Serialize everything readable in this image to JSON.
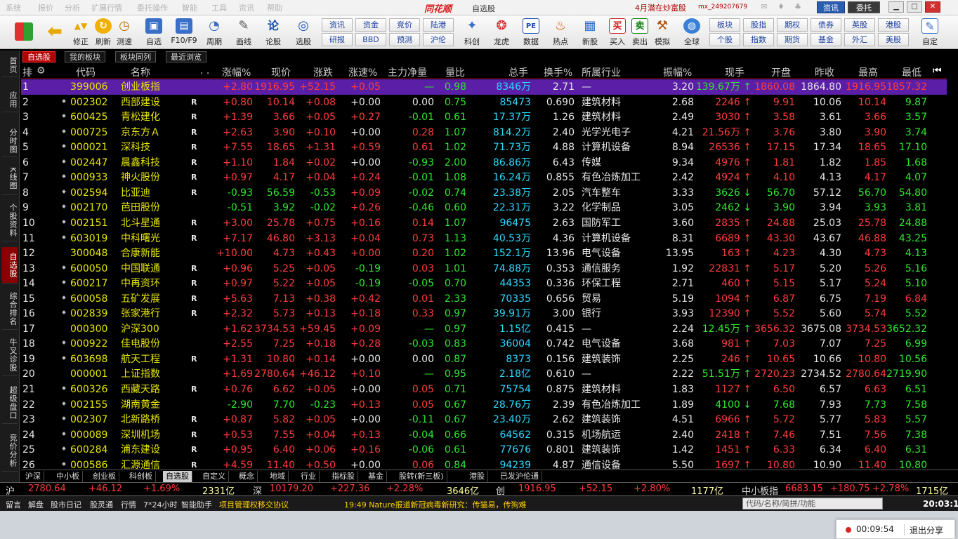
{
  "menu": {
    "items": [
      "系统",
      "报价",
      "分析",
      "扩展行情",
      "委托操作",
      "智能",
      "工具",
      "资讯",
      "帮助"
    ],
    "logo": "同花顺",
    "window_title": "自选股",
    "promo": "4月潜在炒富股",
    "account": "mx_249207679",
    "btn_zixun": "资讯",
    "btn_weituo": "委托"
  },
  "toolbar": {
    "big": [
      {
        "label": "",
        "icon": "colorful-grid-icon"
      },
      {
        "label": "",
        "icon": "back-arrow-icon"
      },
      {
        "label": "修正",
        "icon": "arrow-updown-icon"
      },
      {
        "label": "刷新",
        "icon": "refresh-icon"
      },
      {
        "label": "测速",
        "icon": "clock-icon"
      },
      {
        "label": "自选",
        "icon": "bookmark-icon"
      },
      {
        "label": "F10/F9",
        "icon": "f10-icon"
      },
      {
        "label": "周期",
        "icon": "cycle-icon"
      },
      {
        "label": "画线",
        "icon": "pencil-icon"
      },
      {
        "label": "论股",
        "icon": "discuss-icon"
      },
      {
        "label": "选股",
        "icon": "stock-pick-icon"
      }
    ],
    "small": [
      "资讯",
      "资金",
      "竞价",
      "陆港",
      "研报",
      "BBD",
      "预测",
      "沪伦"
    ],
    "big2": [
      {
        "label": "科创",
        "icon": "star-icon"
      },
      {
        "label": "龙虎",
        "icon": "dragon-icon"
      },
      {
        "label": "数据",
        "icon": "pe-icon"
      },
      {
        "label": "热点",
        "icon": "fire-icon"
      },
      {
        "label": "新股",
        "icon": "new-stock-icon"
      },
      {
        "label": "买入",
        "icon": "buy-icon",
        "glyph": "买"
      },
      {
        "label": "卖出",
        "icon": "sell-icon",
        "glyph": "卖"
      },
      {
        "label": "模拟",
        "icon": "hammer-icon"
      },
      {
        "label": "全球",
        "icon": "globe-icon"
      }
    ],
    "small2": [
      "板块",
      "股指",
      "期权",
      "债券",
      "英股",
      "港股",
      "个股",
      "指数",
      "期货",
      "基金",
      "外汇",
      "美股"
    ],
    "custom": "自定"
  },
  "sidebar": [
    "首页",
    "应用",
    "分时图",
    "K线图",
    "个股资料",
    "自选股",
    "综合排名",
    "牛叉诊股",
    "超级盘口",
    "竞价分析"
  ],
  "subtabs": [
    "自选股",
    "我的板块",
    "板块同列",
    "最近浏览"
  ],
  "headers": {
    "idx": "排",
    "code": "代码",
    "name": "名称",
    "dots": ". .",
    "chg_pct": "涨幅%",
    "price": "现价",
    "chg": "涨跌",
    "speed": "涨速%",
    "mainflow": "主力净量",
    "volratio": "量比",
    "vol": "总手",
    "turnover": "换手%",
    "industry": "所属行业",
    "amplitude": "振幅%",
    "lastvol": "现手",
    "open": "开盘",
    "preclose": "昨收",
    "high": "最高",
    "low": "最低"
  },
  "rows": [
    [
      "1",
      "399006",
      "创业板指",
      "",
      "+2.80",
      "1916.95",
      "+52.15",
      "+0.05",
      "—",
      "0.98",
      "8346万",
      "2.71",
      "—",
      "3.20",
      "139.67万 ↑",
      "1860.08",
      "1864.80",
      "1916.95",
      "1857.32",
      "r",
      "r",
      "r",
      "r",
      "g",
      "g",
      "g",
      "g",
      "r",
      "r"
    ],
    [
      "2",
      "002302",
      "西部建设",
      "R",
      "+0.80",
      "10.14",
      "+0.08",
      "+0.00",
      "0.00",
      "0.75",
      "85473",
      "0.690",
      "建筑材料",
      "2.68",
      "2246 ↑",
      "9.91",
      "10.06",
      "10.14",
      "9.87",
      "r",
      "r",
      "r",
      "w",
      "w",
      "g",
      "g",
      "r",
      "r",
      "g"
    ],
    [
      "3",
      "600425",
      "青松建化",
      "R",
      "+1.39",
      "3.66",
      "+0.05",
      "+0.27",
      "-0.01",
      "0.61",
      "17.37万",
      "1.26",
      "建筑材料",
      "2.49",
      "3030 ↑",
      "3.58",
      "3.61",
      "3.66",
      "3.57",
      "r",
      "r",
      "r",
      "r",
      "g",
      "g",
      "g",
      "r",
      "r",
      "g"
    ],
    [
      "4",
      "000725",
      "京东方Ａ",
      "R",
      "+2.63",
      "3.90",
      "+0.10",
      "+0.00",
      "0.28",
      "1.07",
      "814.2万",
      "2.40",
      "光学光电子",
      "4.21",
      "21.56万 ↑",
      "3.76",
      "3.80",
      "3.90",
      "3.74",
      "r",
      "r",
      "r",
      "w",
      "r",
      "g",
      "g",
      "r",
      "r",
      "g"
    ],
    [
      "5",
      "000021",
      "深科技",
      "R",
      "+7.55",
      "18.65",
      "+1.31",
      "+0.59",
      "0.61",
      "1.02",
      "71.73万",
      "4.88",
      "计算机设备",
      "8.94",
      "26536 ↑",
      "17.15",
      "17.34",
      "18.65",
      "17.10",
      "r",
      "r",
      "r",
      "r",
      "r",
      "g",
      "g",
      "r",
      "r",
      "g"
    ],
    [
      "6",
      "002447",
      "晨鑫科技",
      "R",
      "+1.10",
      "1.84",
      "+0.02",
      "+0.00",
      "-0.93",
      "2.00",
      "86.86万",
      "6.43",
      "传媒",
      "9.34",
      "4976 ↑",
      "1.81",
      "1.82",
      "1.85",
      "1.68",
      "r",
      "r",
      "r",
      "w",
      "g",
      "g",
      "g",
      "r",
      "r",
      "g"
    ],
    [
      "7",
      "000933",
      "神火股份",
      "R",
      "+0.97",
      "4.17",
      "+0.04",
      "+0.24",
      "-0.01",
      "1.08",
      "16.24万",
      "0.855",
      "有色冶炼加工",
      "2.42",
      "4924 ↑",
      "4.10",
      "4.13",
      "4.17",
      "4.07",
      "r",
      "r",
      "r",
      "r",
      "g",
      "g",
      "g",
      "r",
      "r",
      "g"
    ],
    [
      "8",
      "002594",
      "比亚迪",
      "R",
      "-0.93",
      "56.59",
      "-0.53",
      "+0.09",
      "-0.02",
      "0.74",
      "23.38万",
      "2.05",
      "汽车整车",
      "3.33",
      "3626 ↓",
      "56.70",
      "57.12",
      "56.70",
      "54.80",
      "g",
      "g",
      "g",
      "r",
      "g",
      "g",
      "g",
      "g",
      "g",
      "g"
    ],
    [
      "9",
      "002170",
      "芭田股份",
      "",
      "-0.51",
      "3.92",
      "-0.02",
      "+0.26",
      "-0.46",
      "0.60",
      "22.31万",
      "3.22",
      "化学制品",
      "3.05",
      "2462 ↓",
      "3.90",
      "3.94",
      "3.93",
      "3.81",
      "g",
      "g",
      "g",
      "r",
      "g",
      "g",
      "g",
      "g",
      "g",
      "g"
    ],
    [
      "10",
      "002151",
      "北斗星通",
      "R",
      "+3.00",
      "25.78",
      "+0.75",
      "+0.16",
      "0.14",
      "1.07",
      "96475",
      "2.63",
      "国防军工",
      "3.60",
      "2835 ↑",
      "24.88",
      "25.03",
      "25.78",
      "24.88",
      "r",
      "r",
      "r",
      "r",
      "r",
      "g",
      "g",
      "r",
      "r",
      "g"
    ],
    [
      "11",
      "603019",
      "中科曙光",
      "R",
      "+7.17",
      "46.80",
      "+3.13",
      "+0.04",
      "0.73",
      "1.13",
      "40.53万",
      "4.36",
      "计算机设备",
      "8.31",
      "6689 ↑",
      "43.30",
      "43.67",
      "46.88",
      "43.25",
      "r",
      "r",
      "r",
      "r",
      "r",
      "g",
      "g",
      "r",
      "r",
      "g"
    ],
    [
      "12",
      "300048",
      "合康新能",
      "",
      "+10.00",
      "4.73",
      "+0.43",
      "+0.00",
      "0.20",
      "1.02",
      "152.1万",
      "13.96",
      "电气设备",
      "13.95",
      "163 ↑",
      "4.23",
      "4.30",
      "4.73",
      "4.13",
      "r",
      "r",
      "r",
      "r",
      "r",
      "g",
      "g",
      "r",
      "r",
      "g"
    ],
    [
      "13",
      "600050",
      "中国联通",
      "R",
      "+0.96",
      "5.25",
      "+0.05",
      "-0.19",
      "0.03",
      "1.01",
      "74.88万",
      "0.353",
      "通信服务",
      "1.92",
      "22831 ↑",
      "5.17",
      "5.20",
      "5.26",
      "5.16",
      "r",
      "r",
      "r",
      "g",
      "r",
      "g",
      "g",
      "r",
      "r",
      "g"
    ],
    [
      "14",
      "600217",
      "中再资环",
      "R",
      "+0.97",
      "5.22",
      "+0.05",
      "-0.19",
      "-0.05",
      "0.70",
      "44353",
      "0.336",
      "环保工程",
      "2.71",
      "460 ↑",
      "5.15",
      "5.17",
      "5.24",
      "5.10",
      "r",
      "r",
      "r",
      "g",
      "g",
      "g",
      "g",
      "r",
      "r",
      "g"
    ],
    [
      "15",
      "600058",
      "五矿发展",
      "R",
      "+5.63",
      "7.13",
      "+0.38",
      "+0.42",
      "0.01",
      "2.33",
      "70335",
      "0.656",
      "贸易",
      "5.19",
      "1094 ↑",
      "6.87",
      "6.75",
      "7.19",
      "6.84",
      "r",
      "r",
      "r",
      "r",
      "r",
      "g",
      "g",
      "r",
      "r",
      "r"
    ],
    [
      "16",
      "002839",
      "张家港行",
      "R",
      "+2.32",
      "5.73",
      "+0.13",
      "+0.18",
      "0.33",
      "0.97",
      "39.91万",
      "3.00",
      "银行",
      "3.93",
      "12390 ↑",
      "5.52",
      "5.60",
      "5.74",
      "5.52",
      "r",
      "r",
      "r",
      "r",
      "r",
      "g",
      "g",
      "r",
      "r",
      "g"
    ],
    [
      "17",
      "000300",
      "沪深300",
      "",
      "+1.62",
      "3734.53",
      "+59.45",
      "+0.09",
      "—",
      "0.97",
      "1.15亿",
      "0.415",
      "—",
      "2.24",
      "12.45万 ↑",
      "3656.32",
      "3675.08",
      "3734.53",
      "3652.32",
      "r",
      "r",
      "r",
      "r",
      "g",
      "g",
      "g",
      "g",
      "r",
      "g"
    ],
    [
      "18",
      "000922",
      "佳电股份",
      "",
      "+2.55",
      "7.25",
      "+0.18",
      "+0.28",
      "-0.03",
      "0.83",
      "36004",
      "0.742",
      "电气设备",
      "3.68",
      "981 ↑",
      "7.03",
      "7.07",
      "7.25",
      "6.99",
      "r",
      "r",
      "r",
      "r",
      "g",
      "g",
      "g",
      "r",
      "r",
      "g"
    ],
    [
      "19",
      "603698",
      "航天工程",
      "R",
      "+1.31",
      "10.80",
      "+0.14",
      "+0.00",
      "0.00",
      "0.87",
      "8373",
      "0.156",
      "建筑装饰",
      "2.25",
      "246 ↑",
      "10.65",
      "10.66",
      "10.80",
      "10.56",
      "r",
      "r",
      "r",
      "w",
      "w",
      "g",
      "g",
      "r",
      "r",
      "g"
    ],
    [
      "20",
      "000001",
      "上证指数",
      "",
      "+1.69",
      "2780.64",
      "+46.12",
      "+0.10",
      "—",
      "0.95",
      "2.18亿",
      "0.610",
      "—",
      "2.22",
      "51.51万 ↑",
      "2720.23",
      "2734.52",
      "2780.64",
      "2719.90",
      "r",
      "r",
      "r",
      "r",
      "g",
      "g",
      "g",
      "g",
      "r",
      "g"
    ],
    [
      "21",
      "600326",
      "西藏天路",
      "R",
      "+0.76",
      "6.62",
      "+0.05",
      "+0.00",
      "0.05",
      "0.71",
      "75754",
      "0.875",
      "建筑材料",
      "1.83",
      "1127 ↑",
      "6.50",
      "6.57",
      "6.63",
      "6.51",
      "r",
      "r",
      "r",
      "w",
      "r",
      "g",
      "g",
      "r",
      "r",
      "g"
    ],
    [
      "22",
      "002155",
      "湖南黄金",
      "",
      "-2.90",
      "7.70",
      "-0.23",
      "+0.13",
      "0.05",
      "0.67",
      "28.76万",
      "2.39",
      "有色冶炼加工",
      "1.89",
      "4100 ↓",
      "7.68",
      "7.93",
      "7.73",
      "7.58",
      "g",
      "g",
      "g",
      "r",
      "r",
      "g",
      "g",
      "g",
      "g",
      "g"
    ],
    [
      "23",
      "002307",
      "北新路桥",
      "R",
      "+0.87",
      "5.82",
      "+0.05",
      "+0.00",
      "-0.11",
      "0.67",
      "23.40万",
      "2.62",
      "建筑装饰",
      "4.51",
      "6966 ↑",
      "5.72",
      "5.77",
      "5.83",
      "5.57",
      "r",
      "r",
      "r",
      "w",
      "g",
      "g",
      "g",
      "r",
      "r",
      "g"
    ],
    [
      "24",
      "000089",
      "深圳机场",
      "R",
      "+0.53",
      "7.55",
      "+0.04",
      "+0.13",
      "-0.04",
      "0.66",
      "64562",
      "0.315",
      "机场航运",
      "2.40",
      "2418 ↑",
      "7.46",
      "7.51",
      "7.56",
      "7.38",
      "r",
      "r",
      "r",
      "r",
      "g",
      "g",
      "g",
      "r",
      "r",
      "g"
    ],
    [
      "25",
      "600284",
      "浦东建设",
      "R",
      "+0.95",
      "6.40",
      "+0.06",
      "+0.16",
      "-0.06",
      "0.61",
      "77676",
      "0.801",
      "建筑装饰",
      "1.42",
      "1451 ↑",
      "6.33",
      "6.34",
      "6.40",
      "6.31",
      "r",
      "r",
      "r",
      "r",
      "g",
      "g",
      "g",
      "r",
      "r",
      "g"
    ],
    [
      "26",
      "000586",
      "汇源通信",
      "R",
      "+4.59",
      "11.40",
      "+0.50",
      "+0.00",
      "0.06",
      "0.84",
      "94239",
      "4.87",
      "通信设备",
      "5.50",
      "1697 ↑",
      "10.80",
      "10.90",
      "11.40",
      "10.80",
      "r",
      "r",
      "r",
      "w",
      "r",
      "g",
      "g",
      "r",
      "r",
      "g"
    ]
  ],
  "bottom_tabs": [
    "沪深",
    "中小板",
    "创业板",
    "科创板",
    "自选股",
    "自定义",
    "概念",
    "地域",
    "行业",
    "指标股",
    "基金",
    "股转(新三板)",
    "港股",
    "已发沪伦通"
  ],
  "index_bar": {
    "sh": {
      "name": "沪",
      "value": "2780.64",
      "chg": "+46.12",
      "pct": "+1.69%",
      "amt": "2331亿"
    },
    "sz": {
      "name": "深",
      "value": "10179.20",
      "chg": "+227.36",
      "pct": "+2.28%",
      "amt": "3646亿"
    },
    "cy": {
      "name": "创",
      "value": "1916.95",
      "chg": "+52.15",
      "pct": "+2.80%",
      "amt": "1177亿"
    },
    "zx": {
      "name": "中小板指",
      "value": "6683.15",
      "chg": "+180.75",
      "pct": "+2.78%",
      "amt": "1715亿"
    }
  },
  "status": {
    "items": [
      "留言",
      "解盘",
      "股市日记",
      "股灵通",
      "行情",
      "7*24小时",
      "智能助手"
    ],
    "notice": "项目管理权移交协议",
    "news": "19:49 Nature报道新冠病毒新研究：传猫易，传狗难",
    "search_placeholder": "代码/名称/简拼/功能",
    "clock": "20:03:10"
  },
  "recorder": {
    "time": "00:09:54",
    "exit": "退出分享"
  },
  "colors": {
    "up": "#ff3c3c",
    "down": "#2ee82e",
    "flat": "#e6e6e6",
    "code": "#e6e600",
    "selected_row": "#5a1fa6",
    "active_tab": "#b00000"
  }
}
